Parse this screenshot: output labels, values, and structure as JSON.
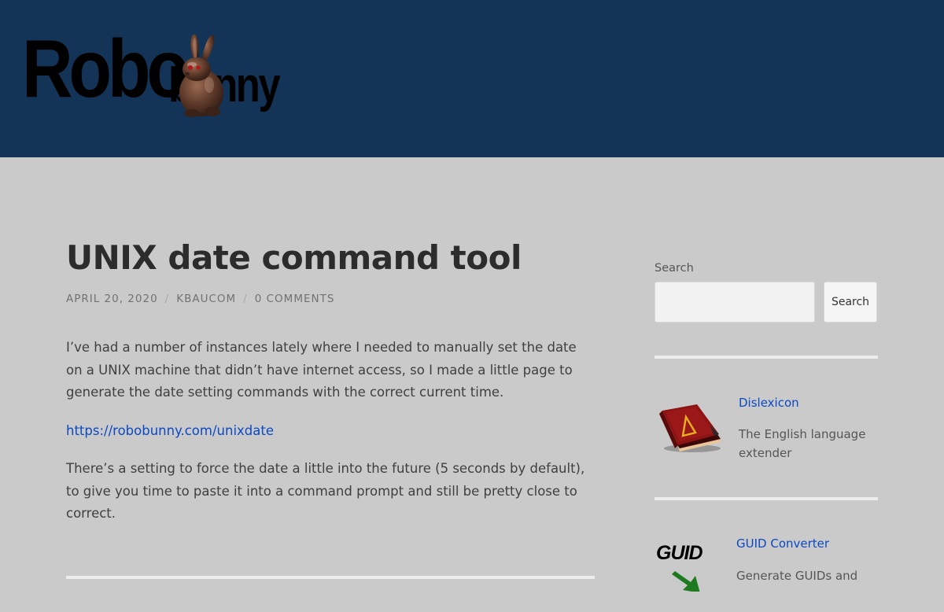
{
  "site": {
    "logo_text_robo": "Robo",
    "logo_text_bunny": "bunny",
    "header_color": "#133357"
  },
  "post": {
    "title": "UNIX date command tool",
    "date": "APRIL 20, 2020",
    "author": "KBAUCOM",
    "comments": "0 COMMENTS",
    "meta_separator": "/",
    "paragraph_1": "I’ve had a number of instances lately where I needed to manually set the date on a UNIX machine that didn’t have internet access, so I made a little page to generate the date setting commands with the correct current time.",
    "link_text": "https://robobunny.com/unixdate",
    "paragraph_2": "There’s a setting to force the date a little into the future (5 seconds by default), to give you time to paste it into a command prompt and still be pretty close to correct."
  },
  "sidebar": {
    "search_label": "Search",
    "search_value": "",
    "search_button": "Search",
    "apps": [
      {
        "name": "Dislexicon",
        "description": "The English language extender",
        "icon": "red-book-icon"
      },
      {
        "name": "GUID Converter",
        "description": "Generate GUIDs and",
        "icon_text": "GUID",
        "icon": "guid-arrow-icon"
      }
    ]
  },
  "colors": {
    "link": "#0b49c4",
    "background": "#cacaca",
    "title": "#2c2c2c"
  }
}
